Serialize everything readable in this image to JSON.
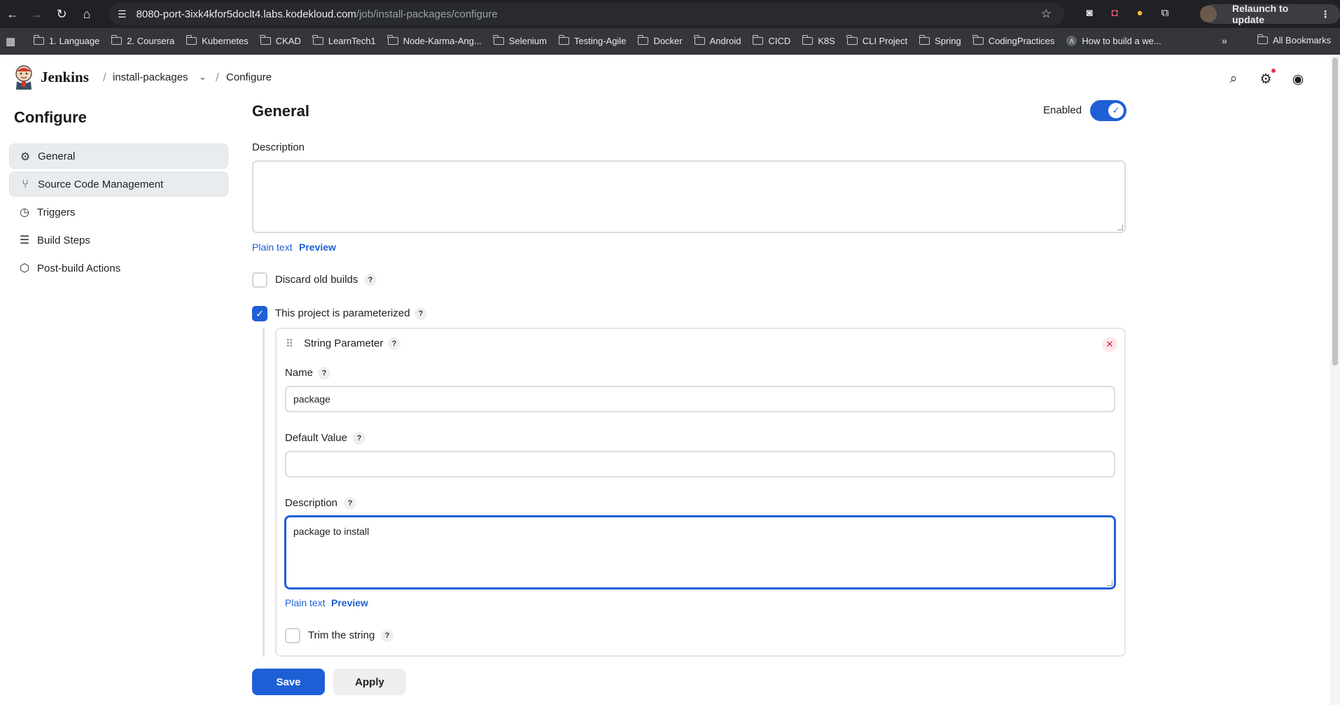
{
  "browser": {
    "url_host": "8080-port-3ixk4kfor5doclt4.labs.kodekloud.com",
    "url_path": "/job/install-packages/configure",
    "relaunch_label": "Relaunch to update",
    "bookmarks": [
      "1. Language",
      "2. Coursera",
      "Kubernetes",
      "CKAD",
      "LearnTech1",
      "Node-Karma-Ang...",
      "Selenium",
      "Testing-Agile",
      "Docker",
      "Android",
      "CICD",
      "K8S",
      "CLI Project",
      "Spring",
      "CodingPractices",
      "How to build a we..."
    ],
    "all_bookmarks": "All Bookmarks"
  },
  "header": {
    "brand": "Jenkins",
    "crumb_job": "install-packages",
    "crumb_page": "Configure"
  },
  "sidebar": {
    "title": "Configure",
    "items": [
      {
        "label": "General",
        "icon": "gear-icon"
      },
      {
        "label": "Source Code Management",
        "icon": "branch-icon"
      },
      {
        "label": "Triggers",
        "icon": "clock-icon"
      },
      {
        "label": "Build Steps",
        "icon": "list-icon"
      },
      {
        "label": "Post-build Actions",
        "icon": "cube-icon"
      }
    ]
  },
  "general": {
    "heading": "General",
    "enabled_label": "Enabled",
    "description_label": "Description",
    "description_value": "",
    "plain_text": "Plain text",
    "preview": "Preview",
    "discard_label": "Discard old builds",
    "parameterized_label": "This project is parameterized"
  },
  "parameter": {
    "type": "String Parameter",
    "name_label": "Name",
    "name_value": "package",
    "default_label": "Default Value",
    "default_value": "",
    "description_label": "Description",
    "description_value": "package to install",
    "plain_text": "Plain text",
    "preview": "Preview",
    "trim_label": "Trim the string"
  },
  "actions": {
    "save": "Save",
    "apply": "Apply"
  },
  "help_glyph": "?",
  "colors": {
    "accent": "#1f5fd6",
    "danger": "#d1213b"
  }
}
